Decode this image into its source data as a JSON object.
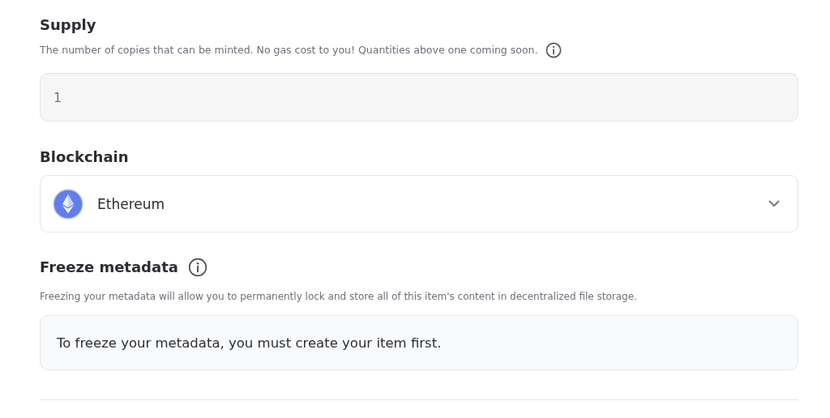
{
  "supply": {
    "title": "Supply",
    "description": "The number of copies that can be minted. No gas cost to you! Quantities above one coming soon.",
    "value": "1",
    "disabled": true
  },
  "blockchain": {
    "title": "Blockchain",
    "value": "Ethereum"
  },
  "freeze_metadata": {
    "title": "Freeze metadata",
    "description": "Freezing your metadata will allow you to permanently lock and store all of this item's content in decentralized file storage.",
    "notice": "To freeze your metadata, you must create your item first."
  }
}
